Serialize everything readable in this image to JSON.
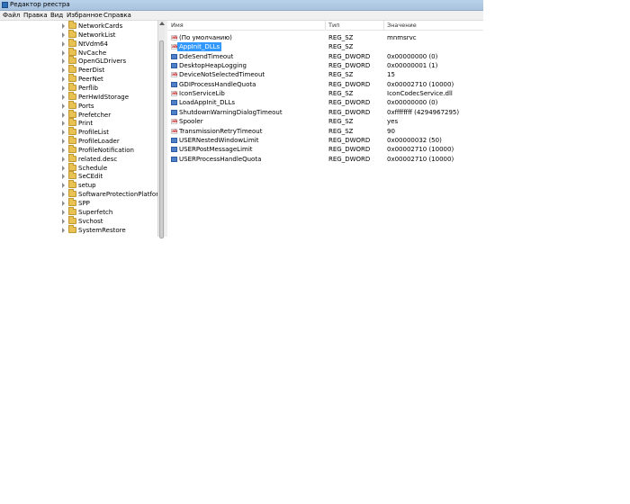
{
  "window": {
    "title": "Редактор реестра"
  },
  "menu": [
    "Файл",
    "Правка",
    "Вид",
    "Избранное",
    "Справка"
  ],
  "tree": {
    "items": [
      {
        "label": "NetworkCards"
      },
      {
        "label": "NetworkList"
      },
      {
        "label": "NtVdm64"
      },
      {
        "label": "NvCache"
      },
      {
        "label": "OpenGLDrivers"
      },
      {
        "label": "PeerDist"
      },
      {
        "label": "PeerNet"
      },
      {
        "label": "Perflib"
      },
      {
        "label": "PerHwIdStorage"
      },
      {
        "label": "Ports"
      },
      {
        "label": "Prefetcher"
      },
      {
        "label": "Print"
      },
      {
        "label": "ProfileList"
      },
      {
        "label": "ProfileLoader"
      },
      {
        "label": "ProfileNotification"
      },
      {
        "label": "related.desc"
      },
      {
        "label": "Schedule"
      },
      {
        "label": "SeCEdit"
      },
      {
        "label": "setup"
      },
      {
        "label": "SoftwareProtectionPlatform"
      },
      {
        "label": "SPP"
      },
      {
        "label": "Superfetch"
      },
      {
        "label": "Svchost"
      },
      {
        "label": "SystemRestore"
      }
    ]
  },
  "columns": {
    "name": "Имя",
    "type": "Тип",
    "data": "Значение"
  },
  "values": [
    {
      "name": "(По умолчанию)",
      "type": "REG_SZ",
      "data": "mnmsrvc",
      "icon": "string-value-icon"
    },
    {
      "name": "AppInit_DLLs",
      "type": "REG_SZ",
      "data": "",
      "icon": "string-value-icon",
      "selected": true
    },
    {
      "name": "DdeSendTimeout",
      "type": "REG_DWORD",
      "data": "0x00000000 (0)",
      "icon": "binary-value-icon"
    },
    {
      "name": "DesktopHeapLogging",
      "type": "REG_DWORD",
      "data": "0x00000001 (1)",
      "icon": "binary-value-icon"
    },
    {
      "name": "DeviceNotSelectedTimeout",
      "type": "REG_SZ",
      "data": "15",
      "icon": "string-value-icon"
    },
    {
      "name": "GDIProcessHandleQuota",
      "type": "REG_DWORD",
      "data": "0x00002710 (10000)",
      "icon": "binary-value-icon"
    },
    {
      "name": "IconServiceLib",
      "type": "REG_SZ",
      "data": "IconCodecService.dll",
      "icon": "string-value-icon"
    },
    {
      "name": "LoadAppInit_DLLs",
      "type": "REG_DWORD",
      "data": "0x00000000 (0)",
      "icon": "binary-value-icon"
    },
    {
      "name": "ShutdownWarningDialogTimeout",
      "type": "REG_DWORD",
      "data": "0xffffffff (4294967295)",
      "icon": "binary-value-icon"
    },
    {
      "name": "Spooler",
      "type": "REG_SZ",
      "data": "yes",
      "icon": "string-value-icon"
    },
    {
      "name": "TransmissionRetryTimeout",
      "type": "REG_SZ",
      "data": "90",
      "icon": "string-value-icon"
    },
    {
      "name": "USERNestedWindowLimit",
      "type": "REG_DWORD",
      "data": "0x00000032 (50)",
      "icon": "binary-value-icon"
    },
    {
      "name": "USERPostMessageLimit",
      "type": "REG_DWORD",
      "data": "0x00002710 (10000)",
      "icon": "binary-value-icon"
    },
    {
      "name": "USERProcessHandleQuota",
      "type": "REG_DWORD",
      "data": "0x00002710 (10000)",
      "icon": "binary-value-icon"
    }
  ],
  "icons": {
    "app": "registry-editor-icon",
    "folder": "folder-icon",
    "expand": "chevron-right-icon"
  },
  "colors": {
    "selection": "#3399ff",
    "folder": "#e8c253",
    "titlebar": "#b9d1ea"
  }
}
